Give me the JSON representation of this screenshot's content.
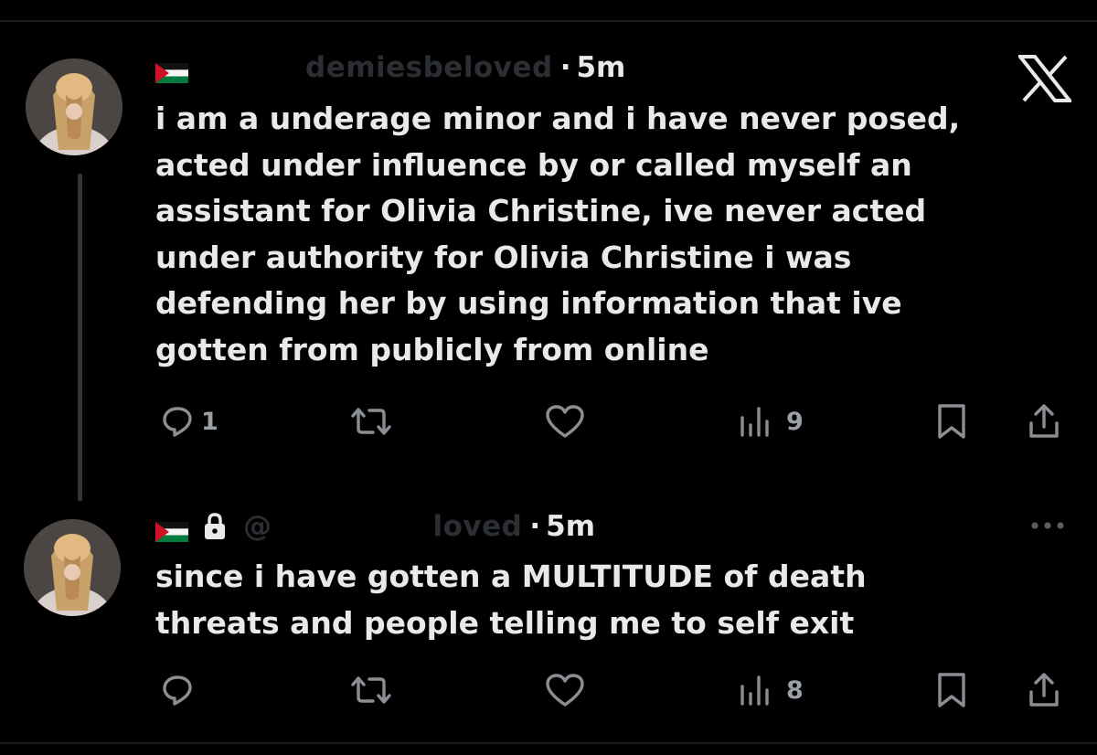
{
  "app": {
    "logo_icon": "x-logo-icon"
  },
  "posts": [
    {
      "handle": "demiesbeloved",
      "flag_icon": "palestine-flag-icon",
      "locked": false,
      "separator": "·",
      "time": "5m",
      "text": "i am a underage minor and i have never posed,\nacted under influence by or called myself an\nassistant for Olivia Christine, ive never acted\nunder authority for Olivia Christine i was\ndefending her by using information that ive\ngotten from publicly from online",
      "actions": {
        "replies": "1",
        "reposts": "",
        "likes": "",
        "views": "9"
      }
    },
    {
      "handle": "@",
      "handle_tail": "loved",
      "flag_icon": "palestine-flag-icon",
      "locked": true,
      "separator": "·",
      "time": "5m",
      "text": "since i have gotten a MULTITUDE of death\nthreats and people telling me to self exit",
      "actions": {
        "replies": "",
        "reposts": "",
        "likes": "",
        "views": "8"
      }
    }
  ],
  "colors": {
    "background": "#000000",
    "text": "#e7e9ea",
    "icon": "#8b8f93",
    "handle_faded": "#2b2f33",
    "flag_red": "#ce1126",
    "flag_green": "#007a3d"
  }
}
